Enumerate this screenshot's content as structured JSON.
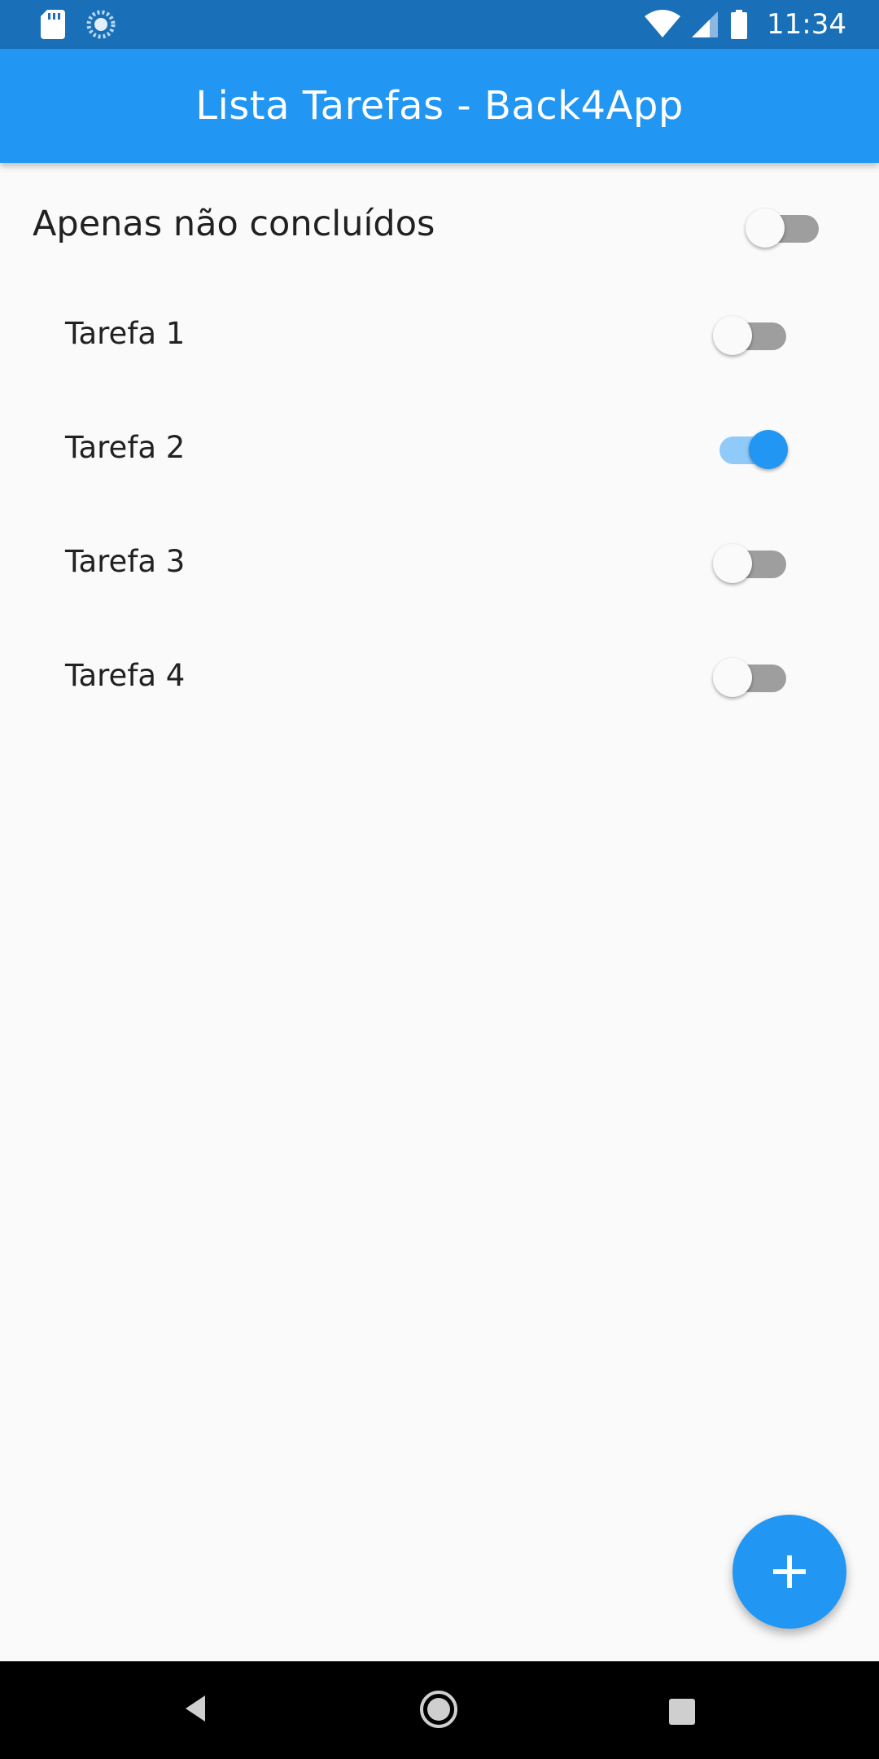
{
  "status_bar": {
    "time": "11:34",
    "icons": [
      "sd-card-icon",
      "sync-spinner-icon",
      "wifi-icon",
      "cellular-signal-icon",
      "battery-icon"
    ]
  },
  "app_bar": {
    "title": "Lista Tarefas - Back4App"
  },
  "filter": {
    "label": "Apenas não concluídos",
    "enabled": false
  },
  "tasks": [
    {
      "label": "Tarefa 1",
      "done": false
    },
    {
      "label": "Tarefa 2",
      "done": true
    },
    {
      "label": "Tarefa 3",
      "done": false
    },
    {
      "label": "Tarefa 4",
      "done": false
    }
  ],
  "fab": {
    "icon": "plus-icon"
  },
  "nav_bar": {
    "icons": [
      "back-icon",
      "home-icon",
      "recents-icon"
    ]
  },
  "colors": {
    "primary": "#2196f3",
    "status_bar": "#1a70b8",
    "switch_on_track": "#90caf9",
    "switch_off_track": "#9e9e9e",
    "background": "#fafafa",
    "text": "#212121"
  }
}
